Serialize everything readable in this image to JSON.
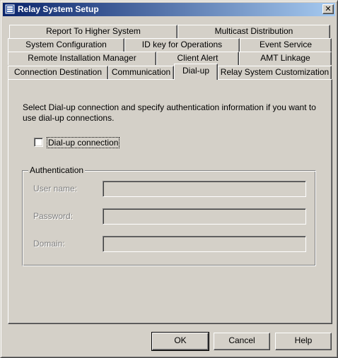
{
  "window": {
    "title": "Relay System Setup"
  },
  "tabs": {
    "row1": [
      "Report To Higher System",
      "Multicast Distribution"
    ],
    "row2": [
      "System Configuration",
      "ID key for Operations",
      "Event Service"
    ],
    "row3": [
      "Remote Installation Manager",
      "Client Alert",
      "AMT Linkage"
    ],
    "row4": [
      "Connection Destination",
      "Communication",
      "Dial-up",
      "Relay System Customization"
    ],
    "active": "Dial-up"
  },
  "dialup": {
    "description": "Select Dial-up connection and specify authentication information if you want to use dial-up connections.",
    "checkbox_label": "Dial-up connection",
    "checkbox_checked": false
  },
  "authentication": {
    "group_label": "Authentication",
    "user_name_label": "User name:",
    "user_name_value": "",
    "password_label": "Password:",
    "password_value": "",
    "domain_label": "Domain:",
    "domain_value": ""
  },
  "buttons": {
    "ok": "OK",
    "cancel": "Cancel",
    "help": "Help"
  }
}
